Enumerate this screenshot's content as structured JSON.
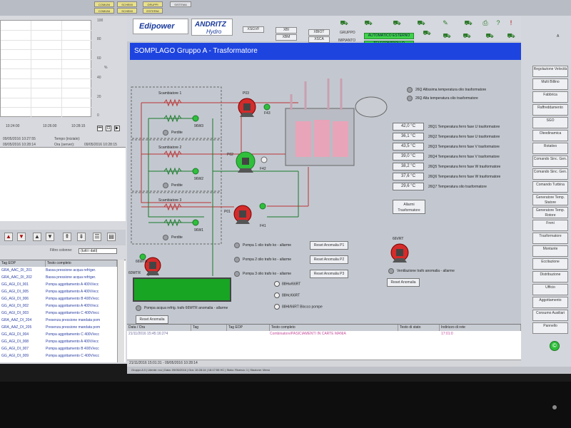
{
  "topbar": {
    "buttons": [
      "COMUNI",
      "SCHEMI",
      "COMUNI",
      "SCHEMI",
      "GRUPPI",
      "SISTEMA",
      "ESTERNI"
    ]
  },
  "left_panel": {
    "y_ticks": [
      "100",
      "90",
      "80",
      "70",
      "60",
      "50",
      "40",
      "30",
      "20",
      "10",
      "0"
    ],
    "y_unit": "%",
    "x_ticks": [
      "10:24:00",
      "10:26:00",
      "10:28:15"
    ],
    "info": [
      {
        "label": "Tempo (iniziale):",
        "value": "09/05/2016 10:27:55"
      },
      {
        "label": "Ora (server):",
        "value": "09/05/2016 10:28:15"
      }
    ],
    "info_left": [
      "09/05/2016 10:27:55",
      "09/05/2016 10:28:14"
    ],
    "filter_label": "Filtro colonne:",
    "filter_value": "(tutti i dati)",
    "table_headers": [
      "Tag EOP",
      "Testo completo"
    ],
    "table_rows": [
      [
        "GRA_AAC_DI_201",
        "Bassa pressione acqua refriger."
      ],
      [
        "GRA_AAC_DI_202",
        "Bassa pressione acqua refriger."
      ],
      [
        "GG_AGI_DI_001",
        "Pompa aggottamento A 400V/ecc"
      ],
      [
        "GG_AGI_DI_005",
        "Pompa aggottamento A 400V/ecc"
      ],
      [
        "GG_AGI_DI_006",
        "Pompa aggottamento B 400V/ecc"
      ],
      [
        "GG_AGI_DI_002",
        "Pompa aggottamento A 400V/ecc"
      ],
      [
        "GG_AGI_DI_003",
        "Pompa aggottamento C 400V/ecc"
      ],
      [
        "GRA_AAZ_DI_204",
        "Presenza pressione mandata pom"
      ],
      [
        "GRA_AAZ_DI_205",
        "Presenza pressione mandata pom"
      ],
      [
        "GG_AGI_DI_004",
        "Pompa aggottamento C 400V/ecc"
      ],
      [
        "GG_AGI_DI_008",
        "Pompa aggottamento A 400V/ecc"
      ],
      [
        "GG_AGI_DI_007",
        "Pompa aggottamento B 400V/ecc"
      ],
      [
        "GG_AGI_DI_009",
        "Pompa aggottamento C 400V/ecc"
      ]
    ]
  },
  "header": {
    "logo_edipower": "Edipower",
    "logo_andritz": "ANDRITZ",
    "logo_hydro": "Hydro",
    "btn_xsgvf": "XSGVF",
    "btn_xbi": "XBI",
    "btn_xbm": "XBM",
    "btn_xbiot": "XBIOT",
    "btn_xsca": "XSCA",
    "label_gruppo": "GRUPPO",
    "label_impianto": "IMPIANTO",
    "badge_auto": "AUTOMATICO ESTERNO",
    "badge_tele": "TELECONTROLLO"
  },
  "page_title": "SOMPLAGO Gruppo A  - Trasformatore",
  "diagram": {
    "exchangers": [
      "Scambiatore 1",
      "Scambiatore 2",
      "Scambiatore 3"
    ],
    "perdite": "Perdite",
    "valves": [
      "96W3",
      "96W2",
      "96W1"
    ],
    "pumps": [
      {
        "id": "P03",
        "flow": "F43"
      },
      {
        "id": "P02",
        "flow": "F42"
      },
      {
        "id": "P01",
        "flow": "F41"
      }
    ],
    "sensors": [
      {
        "value": "42,0 °C",
        "label": "26Q1 Temperatura ferro fase U trasformatore"
      },
      {
        "value": "36,1 °C",
        "label": "26Q2 Temperatura ferro fase U trasformatore"
      },
      {
        "value": "43,5 °C",
        "label": "26Q3 Temperatura ferro fase V trasformatore"
      },
      {
        "value": "39,0 °C",
        "label": "26Q4 Temperatura ferro fase V trasformatore"
      },
      {
        "value": "38,2 °C",
        "label": "26Q5 Temperatura ferro fase W trasformatore"
      },
      {
        "value": "37,6 °C",
        "label": "26Q6 Temperatura ferro fase W trasformatore"
      },
      {
        "value": "29,6 °C",
        "label": "26Q7 Temperatura olio trasformatore"
      }
    ],
    "alarms_top": [
      "26Q Altissima temperatura olio trasformatore",
      "26Q Alta temperatura olio trasformatore"
    ],
    "alarm_button": "Allarmi Trasformatore",
    "pump_alarms": [
      {
        "label": "Pompa 1 olio trafo ko - allarme",
        "button": "Reset Anomalia P1"
      },
      {
        "label": "Pompa 2 olio trafo ko - allarme",
        "button": "Reset Anomalia P2"
      },
      {
        "label": "Pompa 3 olio trafo ko - allarme",
        "button": "Reset Anomalia P3"
      }
    ],
    "fan_label": "66VRT",
    "fan_alarm": "Ventilazione trafo anomalia - allarme",
    "fan_reset": "Reset Anomalia",
    "left_pump_label": "66WTA",
    "left_pump_id": "60WTR",
    "levels": [
      "88Hw/66RT",
      "88Hc/66RT",
      "88Hl/66RT Blocco pompe"
    ],
    "refrig_alarm": "Pompa acqua refrig. trafo 66WTR anomalia - allarme",
    "refrig_reset": "Reset Anomalia"
  },
  "event_table": {
    "headers": [
      "Data / Ora",
      "Tag",
      "Tag EOP",
      "Testo completo",
      "Testo di stato",
      "Indirizzo di rete"
    ],
    "row": {
      "date": "21/11/2016 15:45:16:274",
      "text": "Combinatore/PASICIAMENTI IN CARTE MANIA",
      "state": "17:01:0"
    },
    "footer": "21/11/2016 15:01:31 - 09/05/2016 10:28:14"
  },
  "right_sidebar": {
    "buttons": [
      "Regolazione Velocità",
      "Multi Billino",
      "Fabbrica",
      "Raffreddamento",
      "SGO",
      "Oleodinamica",
      "Rotativo",
      "Comando Sinc. Gen.",
      "Comando Sinc. Gen.",
      "Comando Turbina",
      "Generatore Temp. Statore",
      "Generatore Temp. Rotore",
      "Freni",
      "Trasformatore",
      "Montante",
      "Eccitazione",
      "Distribuzione",
      "Ufficio",
      "Aggottamento",
      "Consumo Ausiliari",
      "Pannello"
    ],
    "title": "A"
  },
  "status_strip": "Gruppo A 0 | Utente: rco | Data: 09/05/2016 | Ora: 10:28:14 | 18:17:55 HC | Stato: Ricerca: 1 | Stazione: Menù",
  "colors": {
    "title_blue": "#1e44e0",
    "pump_red": "#d42b2b",
    "pump_green": "#2fbf3b",
    "tank_green": "#18a524",
    "badge_green": "#3fd24a"
  }
}
